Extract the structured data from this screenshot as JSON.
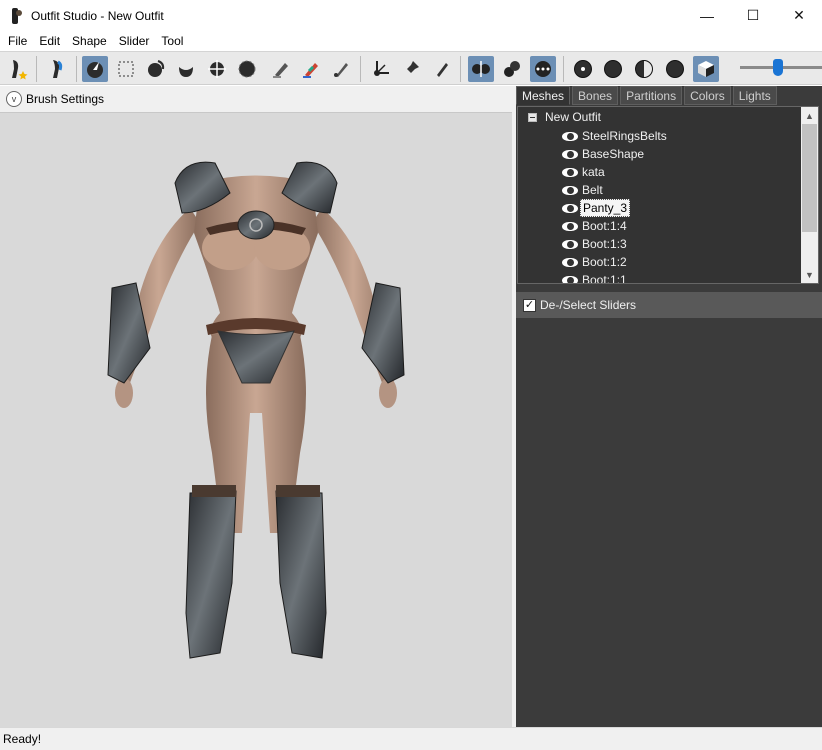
{
  "window": {
    "title": "Outfit Studio - New Outfit",
    "minimize": "—",
    "maximize": "☐",
    "close": "✕"
  },
  "menu": [
    "File",
    "Edit",
    "Shape",
    "Slider",
    "Tool"
  ],
  "toolbar": {
    "slider_value_fraction": 0.45
  },
  "brush_settings": {
    "label": "Brush Settings",
    "toggle": "v"
  },
  "tabs": [
    "Meshes",
    "Bones",
    "Partitions",
    "Colors",
    "Lights"
  ],
  "active_tab": "Meshes",
  "tree": {
    "root": "New Outfit",
    "items": [
      "SteelRingsBelts",
      "BaseShape",
      "kata",
      "Belt",
      "Panty_3",
      "Boot:1:4",
      "Boot:1:3",
      "Boot:1:2",
      "Boot:1:1"
    ],
    "selected": "Panty_3"
  },
  "sliders": {
    "checkbox_label": "De-/Select Sliders",
    "checked": true,
    "check_mark": "✓"
  },
  "status": {
    "text": "Ready!"
  },
  "colors": {
    "panel_dark": "#3b3b3b",
    "toolbar_toggle_on": "#6c8fb5",
    "slider_thumb": "#1a74d4",
    "viewport_bg": "#d9d9d9"
  }
}
